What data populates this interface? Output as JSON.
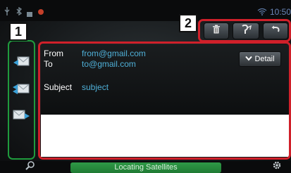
{
  "status_bar": {
    "time": "10:50",
    "icons": [
      "usb-icon",
      "bluetooth-icon",
      "battery-icon",
      "record-icon",
      "wifi-icon"
    ]
  },
  "callouts": {
    "side_buttons": "1",
    "toolbar": "2"
  },
  "toolbar": {
    "buttons": [
      "trash-icon",
      "reply-icon",
      "back-arrow-icon"
    ]
  },
  "side_buttons": [
    "inbox-icon",
    "compose-icon",
    "forward-icon"
  ],
  "message": {
    "from_label": "From",
    "from_value": "from@gmail.com",
    "to_label": "To",
    "to_value": "to@gmail.com",
    "subject_label": "Subject",
    "subject_value": "subject",
    "detail_label": "Detail"
  },
  "bottom_bar": {
    "status_text": "Locating Satellites",
    "icons": [
      "search-icon",
      "settings-gear-icon"
    ]
  },
  "colors": {
    "highlight_red": "#d0202a",
    "highlight_green": "#1f9b3d",
    "link_blue": "#4fb0d8",
    "status_green": "#2f9a47"
  }
}
